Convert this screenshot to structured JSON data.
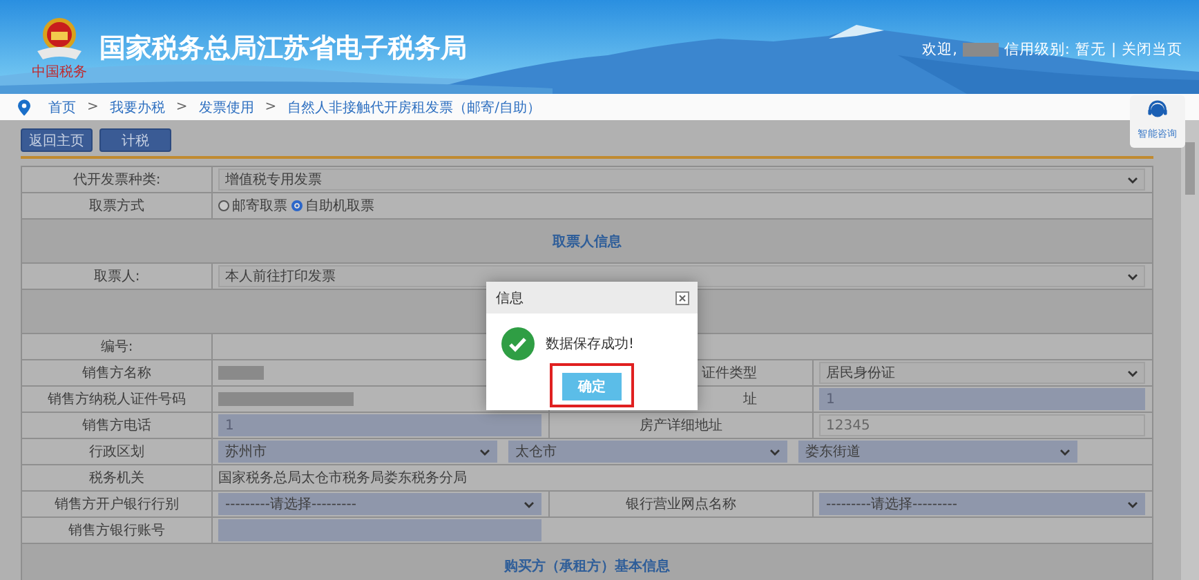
{
  "header": {
    "title": "国家税务总局江苏省电子税务局",
    "logo_caption": "中国税务",
    "welcome": "欢迎,",
    "credit_label": "信用级别:",
    "credit_value": "暂无",
    "divider": "|",
    "close_link": "关闭当页"
  },
  "breadcrumb": {
    "separator": ">",
    "items": [
      {
        "label": "首页"
      },
      {
        "label": "我要办税"
      },
      {
        "label": "发票使用"
      },
      {
        "label": "自然人非接触代开房租发票（邮寄/自助）"
      }
    ]
  },
  "assistant": {
    "label": "智能咨询"
  },
  "toolbar": [
    "返回主页",
    "计税"
  ],
  "rows": [
    {
      "kind": "cells",
      "cells": [
        {
          "kind": "label",
          "text": "代开发票种类:"
        },
        {
          "kind": "select",
          "text": "增值税专用发票"
        }
      ]
    },
    {
      "kind": "radio",
      "label": "取票方式",
      "options": [
        {
          "label": "邮寄取票",
          "selected": false
        },
        {
          "label": "自助机取票",
          "selected": true
        }
      ]
    },
    {
      "kind": "section",
      "title": "取票人信息"
    },
    {
      "kind": "cells",
      "cells": [
        {
          "kind": "label",
          "text": "取票人:"
        },
        {
          "kind": "select",
          "text": "本人前往打印发票"
        }
      ]
    },
    {
      "kind": "section"
    },
    {
      "kind": "cells",
      "cells": [
        {
          "kind": "label",
          "text": "编号:"
        },
        {
          "kind": "empty"
        }
      ]
    },
    {
      "kind": "cells",
      "cells": [
        {
          "kind": "label",
          "text": "销售方名称"
        },
        {
          "kind": "redacted"
        },
        {
          "kind": "label_cut",
          "text": "证件类型"
        },
        {
          "kind": "select",
          "text": "居民身份证"
        }
      ]
    },
    {
      "kind": "cells",
      "cells": [
        {
          "kind": "label",
          "text": "销售方纳税人证件号码"
        },
        {
          "kind": "redacted_long"
        },
        {
          "kind": "label_cut",
          "text": "址"
        },
        {
          "kind": "input_blue",
          "text": "1"
        }
      ]
    },
    {
      "kind": "cells",
      "cells": [
        {
          "kind": "label",
          "text": "销售方电话"
        },
        {
          "kind": "input_blue",
          "text": "1"
        },
        {
          "kind": "label",
          "text": "房产详细地址"
        },
        {
          "kind": "input",
          "text": "12345"
        }
      ]
    },
    {
      "kind": "selects",
      "label": "行政区划",
      "selects": [
        {
          "text": "苏州市"
        },
        {
          "text": "太仓市"
        },
        {
          "text": "娄东街道"
        }
      ]
    },
    {
      "kind": "cells",
      "cells": [
        {
          "kind": "label",
          "text": "税务机关"
        },
        {
          "kind": "text",
          "text": "国家税务总局太仓市税务局娄东税务分局"
        }
      ]
    },
    {
      "kind": "cells",
      "cells": [
        {
          "kind": "label",
          "text": "销售方开户银行行别"
        },
        {
          "kind": "select_blue",
          "text": "---------请选择---------"
        },
        {
          "kind": "label",
          "text": "银行营业网点名称"
        },
        {
          "kind": "select_blue",
          "text": "---------请选择---------"
        }
      ]
    },
    {
      "kind": "cells",
      "cells": [
        {
          "kind": "label",
          "text": "销售方银行账号"
        },
        {
          "kind": "input_blue_short",
          "text": ""
        }
      ]
    },
    {
      "kind": "section",
      "title": "购买方（承租方）基本信息"
    }
  ],
  "dialog": {
    "title": "信息",
    "message": "数据保存成功!",
    "button": "确定"
  }
}
